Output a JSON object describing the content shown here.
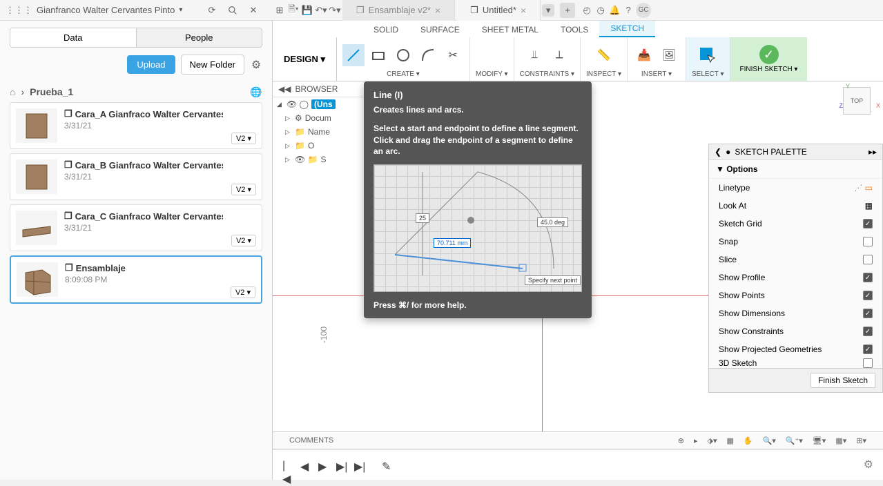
{
  "topbar": {
    "username": "Gianfranco Walter Cervantes Pinto",
    "avatar": "GC",
    "tabs": [
      {
        "label": "Ensamblaje v2*",
        "active": false
      },
      {
        "label": "Untitled*",
        "active": true
      }
    ]
  },
  "leftpanel": {
    "tab_data": "Data",
    "tab_people": "People",
    "upload": "Upload",
    "new_folder": "New Folder",
    "breadcrumb": "Prueba_1",
    "files": [
      {
        "name": "Cara_A Gianfraco Walter Cervantes Pi...",
        "date": "3/31/21",
        "ver": "V2"
      },
      {
        "name": "Cara_B Gianfraco Walter Cervantes Pi...",
        "date": "3/31/21",
        "ver": "V2"
      },
      {
        "name": "Cara_C Gianfraco Walter Cervantes Pi...",
        "date": "3/31/21",
        "ver": "V2"
      },
      {
        "name": "Ensamblaje",
        "date": "8:09:08 PM",
        "ver": "V2"
      }
    ]
  },
  "ribbon": {
    "design": "DESIGN",
    "tabs": {
      "solid": "SOLID",
      "surface": "SURFACE",
      "sheet": "SHEET METAL",
      "tools": "TOOLS",
      "sketch": "SKETCH"
    },
    "groups": {
      "create": "CREATE",
      "modify": "MODIFY",
      "constraints": "CONSTRAINTS",
      "inspect": "INSPECT",
      "insert": "INSERT",
      "select": "SELECT",
      "finish": "FINISH SKETCH"
    }
  },
  "browser": {
    "title": "BROWSER",
    "root": "(Uns",
    "items": [
      "Docum",
      "Name",
      "O",
      "S"
    ]
  },
  "tooltip": {
    "title": "Line (I)",
    "subtitle": "Creates lines and arcs.",
    "body": "Select a start and endpoint to define a line segment. Click and drag the endpoint of a segment to define an arc.",
    "hint": "Press ⌘/ for more help.",
    "dim_len": "70.711 mm",
    "dim_ang": "45.0 deg",
    "dim_25": "25",
    "hover": "Specify next point"
  },
  "palette": {
    "title": "SKETCH PALETTE",
    "section": "Options",
    "rows": [
      {
        "label": "Linetype",
        "kind": "icons"
      },
      {
        "label": "Look At",
        "kind": "icon"
      },
      {
        "label": "Sketch Grid",
        "kind": "check",
        "on": true
      },
      {
        "label": "Snap",
        "kind": "check",
        "on": false
      },
      {
        "label": "Slice",
        "kind": "check",
        "on": false
      },
      {
        "label": "Show Profile",
        "kind": "check",
        "on": true
      },
      {
        "label": "Show Points",
        "kind": "check",
        "on": true
      },
      {
        "label": "Show Dimensions",
        "kind": "check",
        "on": true
      },
      {
        "label": "Show Constraints",
        "kind": "check",
        "on": true
      },
      {
        "label": "Show Projected Geometries",
        "kind": "check",
        "on": true
      },
      {
        "label": "3D Sketch",
        "kind": "check",
        "on": false
      }
    ],
    "finish": "Finish Sketch"
  },
  "canvas": {
    "axis_label": "-100",
    "cube": "TOP"
  },
  "comments": {
    "label": "COMMENTS"
  }
}
